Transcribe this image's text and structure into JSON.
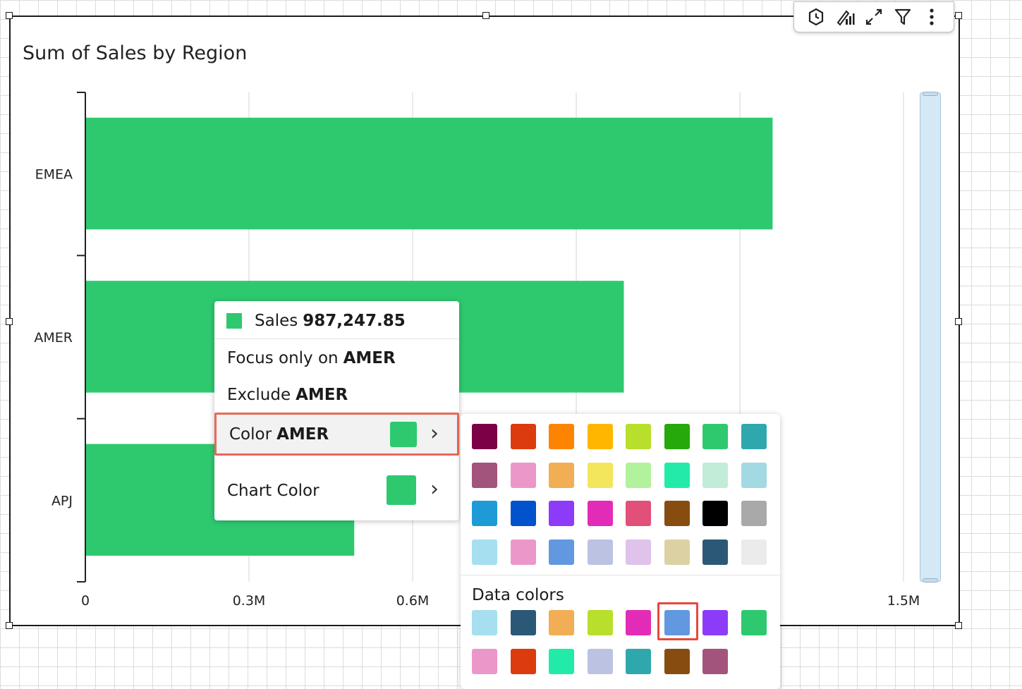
{
  "visual": {
    "title": "Sum of Sales by Region",
    "toolbar_icons": [
      "insight-icon",
      "forecast-icon",
      "expand-icon",
      "filter-icon",
      "more-options-icon"
    ]
  },
  "chart_data": {
    "type": "bar",
    "orientation": "horizontal",
    "title": "Sum of Sales by Region",
    "categories": [
      "EMEA",
      "AMER",
      "APJ"
    ],
    "series": [
      {
        "values": [
          1260000,
          987247.85,
          493000
        ],
        "color": "#2ec96f"
      }
    ],
    "xlim": [
      0,
      1500000
    ],
    "x_ticks": [
      {
        "value": 0,
        "label": "0"
      },
      {
        "value": 300000,
        "label": "0.3M"
      },
      {
        "value": 600000,
        "label": "0.6M"
      },
      {
        "value": 900000,
        "label": ""
      },
      {
        "value": 1200000,
        "label": ""
      },
      {
        "value": 1500000,
        "label": "1.5M"
      }
    ],
    "grid": true
  },
  "context_menu": {
    "tooltip_label": "Sales",
    "tooltip_value": "987,247.85",
    "focus_label": "Focus only on",
    "focus_target": "AMER",
    "exclude_label": "Exclude",
    "exclude_target": "AMER",
    "color_label": "Color",
    "color_target": "AMER",
    "chart_color_label": "Chart Color",
    "current_color": "#2ec96f"
  },
  "palette": {
    "colors": [
      [
        "#7b0046",
        "#dc3b0e",
        "#fd8400",
        "#ffb600",
        "#b8df2c",
        "#26a90b",
        "#2ec96f",
        "#2fa8ad"
      ],
      [
        "#a3547c",
        "#ec97c9",
        "#f1ae55",
        "#f3e65d",
        "#b2f29d",
        "#22ebaa",
        "#c2ecd8",
        "#a3d9e2"
      ],
      [
        "#1e9bd7",
        "#0053cc",
        "#8c3cf9",
        "#e22cb8",
        "#e2507a",
        "#874d10",
        "#000000",
        "#a9a9a9"
      ],
      [
        "#a5dff0",
        "#ec97c9",
        "#6198e0",
        "#bcc2e2",
        "#dfc3ea",
        "#dcd1a2",
        "#2b5877",
        "#ebebeb"
      ]
    ],
    "data_colors_label": "Data colors",
    "data_colors": [
      [
        "#a5dff0",
        "#2b5877",
        "#f1ae55",
        "#b8df2c",
        "#e22cb8",
        "#6198e0",
        "#8c3cf9",
        "#2ec96f"
      ],
      [
        "#ec97c9",
        "#dc3b0e",
        "#22ebaa",
        "#bcc2e2",
        "#2fa8ad",
        "#874d10",
        "#a3547c"
      ]
    ],
    "selected_data_color": "#6198e0"
  }
}
